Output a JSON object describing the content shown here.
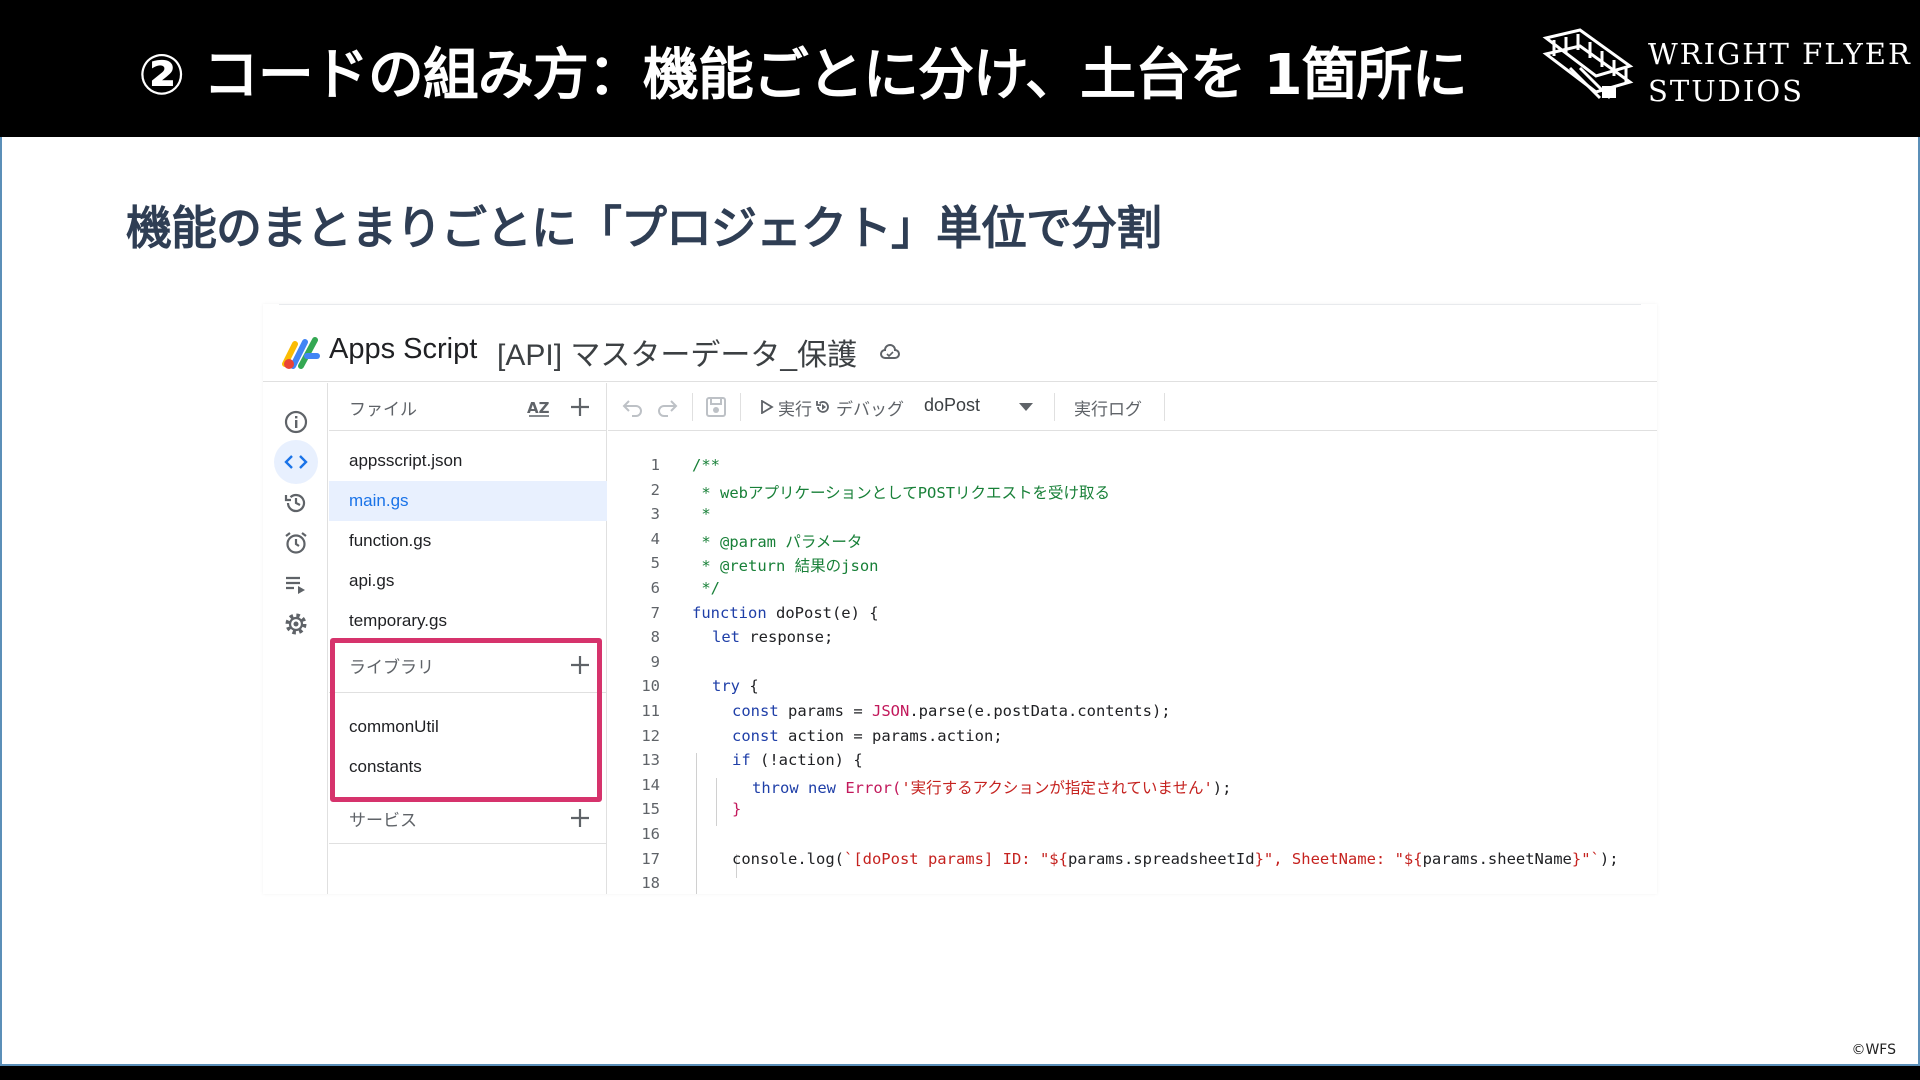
{
  "slide": {
    "title": "② コードの組み方：機能ごとに分け、土台を 1箇所に",
    "subtitle": "機能のまとまりごとに「プロジェクト」単位で分割",
    "logo_line1": "WRIGHT FLYER",
    "logo_line2": "STUDIOS",
    "copyright": "©WFS",
    "highlight_color": "#d6336c"
  },
  "app": {
    "name": "Apps Script",
    "project_title": "[API] マスターデータ_保護"
  },
  "rail": {
    "icons": [
      "info-icon",
      "code-icon",
      "history-icon",
      "alarm-icon",
      "executions-icon",
      "settings-icon"
    ],
    "active": "code-icon"
  },
  "files": {
    "header": "ファイル",
    "sort_label": "AZ",
    "items": [
      "appsscript.json",
      "main.gs",
      "function.gs",
      "api.gs",
      "temporary.gs"
    ],
    "selected": "main.gs"
  },
  "libraries": {
    "header": "ライブラリ",
    "items": [
      "commonUtil",
      "constants"
    ]
  },
  "services": {
    "header": "サービス"
  },
  "toolbar": {
    "run_label": "実行",
    "debug_label": "デバッグ",
    "function_select": "doPost",
    "log_label": "実行ログ"
  },
  "code": {
    "line_numbers": [
      "1",
      "2",
      "3",
      "4",
      "5",
      "6",
      "7",
      "8",
      "9",
      "10",
      "11",
      "12",
      "13",
      "14",
      "15",
      "16",
      "17",
      "18"
    ],
    "comment_1": "/**",
    "comment_2": " * webアプリケーションとしてPOSTリクエストを受け取る",
    "comment_3": " *",
    "comment_4": " * @param パラメータ",
    "comment_5": " * @return 結果のjson",
    "comment_6": " */",
    "l7_kw": "function",
    "l7_rest": " doPost(e) {",
    "l8_kw": "let",
    "l8_rest": " response;",
    "l10_kw": "try",
    "l10_rest": " {",
    "l11_kw": "const",
    "l11_a": " params = ",
    "l11_json": "JSON",
    "l11_b": ".parse(e.postData.contents);",
    "l12_kw": "const",
    "l12_rest": " action = params.action;",
    "l13_kw": "if",
    "l13_rest": " (!action) {",
    "l14_kw": "throw new",
    "l14_err": " Error(",
    "l14_str": "'実行するアクションが指定されていません'",
    "l14_end": ");",
    "l15": "}",
    "l17_a": "console.log(",
    "l17_s1": "`[doPost params] ID: \"${",
    "l17_b": "params.spreadsheetId",
    "l17_s2": "}\", SheetName: \"${",
    "l17_c": "params.sheetName",
    "l17_s3": "}\"`",
    "l17_end": ");"
  }
}
